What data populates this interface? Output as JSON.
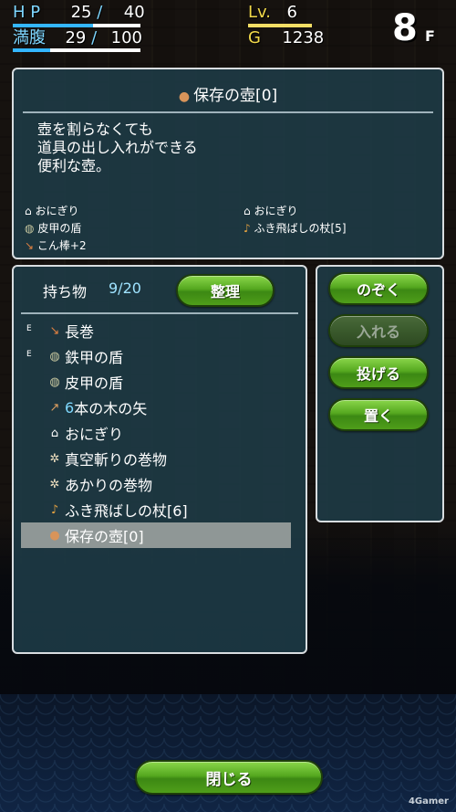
{
  "hud": {
    "hp_label": "H P",
    "hp_current": "25",
    "hp_sep": "/",
    "hp_max": "40",
    "hunger_label": "満腹",
    "hunger_current": "29",
    "hunger_sep": "/",
    "hunger_max": "100",
    "level_label": "Lv.",
    "level": "6",
    "gold_label": "G",
    "gold": "1238",
    "floor": "8",
    "floor_unit": "F",
    "hp_fraction": 0.625,
    "hunger_fraction": 0.29
  },
  "description": {
    "title": "保存の壺[0]",
    "title_icon": "pot-icon",
    "text": "壺を割らなくても\n道具の出し入れができる\n便利な壺。",
    "equip_left": [
      {
        "icon": "onigiri-icon",
        "glyph": "⌂",
        "label": "おにぎり"
      },
      {
        "icon": "shield-icon",
        "glyph": "◍",
        "label": "皮甲の盾"
      },
      {
        "icon": "club-icon",
        "glyph": "↘",
        "label": "こん棒+2"
      }
    ],
    "equip_right": [
      {
        "icon": "onigiri-icon",
        "glyph": "⌂",
        "label": "おにぎり"
      },
      {
        "icon": "staff-icon",
        "glyph": "♪",
        "label": "ふき飛ばしの杖[5]"
      }
    ]
  },
  "inventory": {
    "header": "持ち物",
    "count": "9/20",
    "sort_label": "整理",
    "items": [
      {
        "equipped": "E",
        "icon": "sword-icon",
        "glyph": "↘",
        "prefix": "",
        "label": "長巻"
      },
      {
        "equipped": "E",
        "icon": "shield-icon",
        "glyph": "◍",
        "prefix": "",
        "label": "鉄甲の盾"
      },
      {
        "equipped": "",
        "icon": "shield-icon",
        "glyph": "◍",
        "prefix": "",
        "label": "皮甲の盾"
      },
      {
        "equipped": "",
        "icon": "arrow-icon",
        "glyph": "↗",
        "prefix": "6",
        "label": "本の木の矢"
      },
      {
        "equipped": "",
        "icon": "onigiri-icon",
        "glyph": "⌂",
        "prefix": "",
        "label": "おにぎり"
      },
      {
        "equipped": "",
        "icon": "scroll-icon",
        "glyph": "✲",
        "prefix": "",
        "label": "真空斬りの巻物"
      },
      {
        "equipped": "",
        "icon": "scroll-icon",
        "glyph": "✲",
        "prefix": "",
        "label": "あかりの巻物"
      },
      {
        "equipped": "",
        "icon": "staff-icon",
        "glyph": "♪",
        "prefix": "",
        "label": "ふき飛ばしの杖[6]"
      },
      {
        "equipped": "",
        "icon": "pot-icon",
        "glyph": "●",
        "prefix": "",
        "label": "保存の壺[0]"
      }
    ],
    "selected_index": 8
  },
  "actions": [
    {
      "label": "のぞく",
      "enabled": true
    },
    {
      "label": "入れる",
      "enabled": false
    },
    {
      "label": "投げる",
      "enabled": true
    },
    {
      "label": "置く",
      "enabled": true
    }
  ],
  "close_label": "閉じる",
  "watermark": "4Gamer",
  "colors": {
    "button_green": "#55a81f",
    "hp_bar": "#34b6ff",
    "hunger_bar": "#34b6ff",
    "level_bar": "#f2d94a",
    "panel_bg": "#1e3c48",
    "selected_row": "#8f9796"
  }
}
